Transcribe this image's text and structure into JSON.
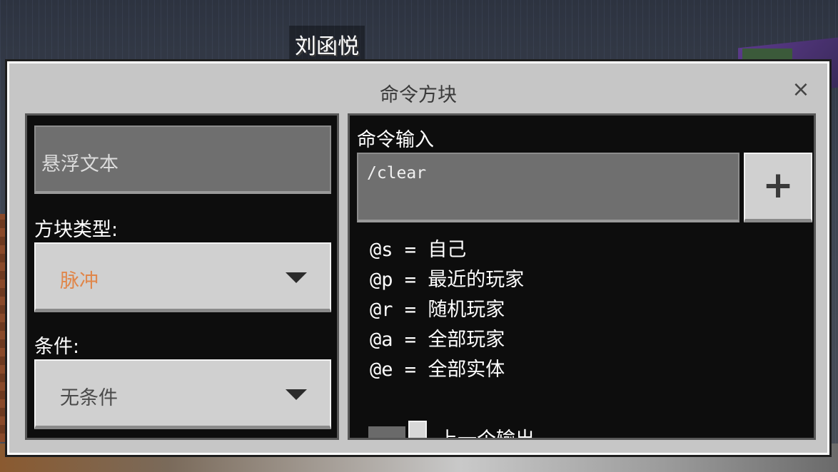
{
  "world": {
    "player_name": "刘函悦"
  },
  "dialog": {
    "title": "命令方块",
    "close_icon": "×"
  },
  "left_panel": {
    "hover_text_placeholder": "悬浮文本",
    "block_type_label": "方块类型:",
    "block_type_value": "脉冲",
    "block_type_color": "#e0864a",
    "condition_label": "条件:",
    "condition_value": "无条件"
  },
  "right_panel": {
    "command_input_label": "命令输入",
    "command_value": "/clear",
    "add_button_label": "+",
    "selectors": [
      {
        "code": "@s",
        "eq": "=",
        "desc": "自己"
      },
      {
        "code": "@p",
        "eq": "=",
        "desc": "最近的玩家"
      },
      {
        "code": "@r",
        "eq": "=",
        "desc": "随机玩家"
      },
      {
        "code": "@a",
        "eq": "=",
        "desc": "全部玩家"
      },
      {
        "code": "@e",
        "eq": "=",
        "desc": "全部实体"
      }
    ],
    "toggle_label": "上一个输出"
  }
}
